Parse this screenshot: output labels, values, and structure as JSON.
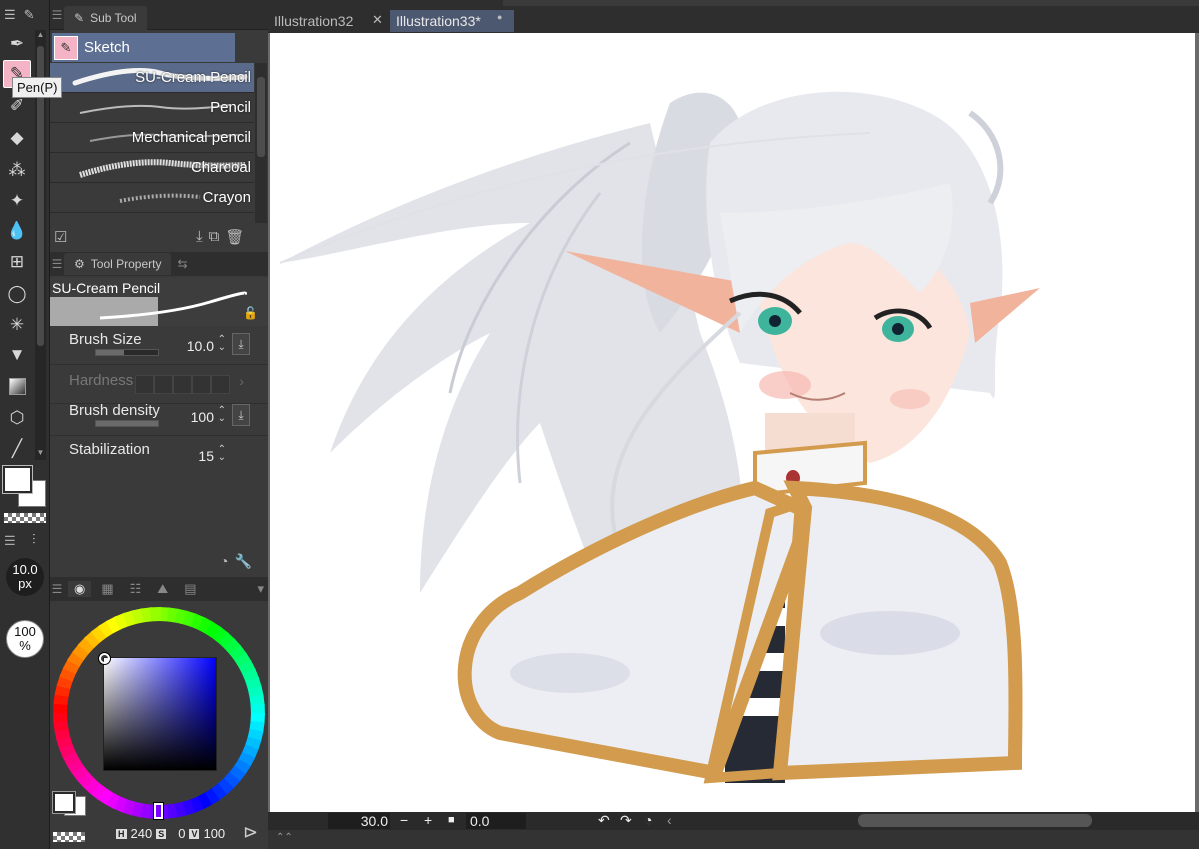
{
  "toolbar": {
    "tooltip": "Pen(P)",
    "tools": [
      "pen-nib-icon",
      "pen-icon",
      "marker-icon",
      "eraser-icon",
      "airbrush-icon",
      "decoration-sparkle-icon",
      "blend-droplets-icon",
      "operation-grid-icon",
      "lasso-icon",
      "magic-wand-icon",
      "fill-bucket-icon",
      "gradient-icon",
      "3d-figure-icon",
      "line-icon"
    ],
    "brush_size_readout": {
      "value": "10.0",
      "unit": "px"
    },
    "opacity_readout": {
      "value": "100",
      "unit": "%"
    }
  },
  "sub_tool": {
    "tab_label": "Sub Tool",
    "group_label": "Sketch",
    "brushes": [
      {
        "name": "SU-Cream Pencil",
        "selected": true
      },
      {
        "name": "Pencil",
        "selected": false
      },
      {
        "name": "Mechanical pencil",
        "selected": false
      },
      {
        "name": "Charcoal",
        "selected": false
      },
      {
        "name": "Crayon",
        "selected": false
      }
    ]
  },
  "tool_property": {
    "tab_label": "Tool Property",
    "preview_name": "SU-Cream Pencil",
    "brush_size": {
      "label": "Brush Size",
      "value": "10.0",
      "fill": 0.45
    },
    "hardness": {
      "label": "Hardness"
    },
    "brush_density": {
      "label": "Brush density",
      "value": "100",
      "fill": 1.0
    },
    "stabilization": {
      "label": "Stabilization",
      "value": "15"
    }
  },
  "color": {
    "main_color": "#ffffff",
    "sub_color": "#ffffff",
    "hue_readout": {
      "h_tag": "H",
      "h": "240",
      "s_tag": "S",
      "s": "0",
      "v_tag": "V",
      "v": "100"
    }
  },
  "documents": {
    "tabs": [
      {
        "title": "Illustration32",
        "active": false
      },
      {
        "title": "Illustration33*",
        "active": true
      }
    ]
  },
  "statusbar": {
    "zoom": "30.0",
    "rotation": "0.0"
  },
  "colors": {
    "accent_blue": "#5d6f92",
    "pen_pink": "#f5b4c6",
    "gold_trim": "#d29b4d"
  }
}
